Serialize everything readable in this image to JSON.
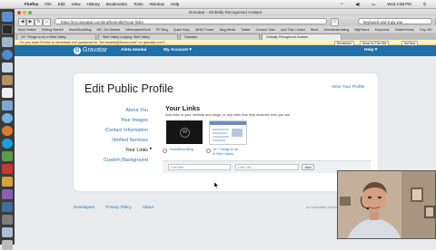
{
  "os": {
    "menu": [
      "Firefox",
      "File",
      "Edit",
      "View",
      "History",
      "Bookmarks",
      "Tools",
      "Window",
      "Help"
    ],
    "clock": "Wed 4:59 PM"
  },
  "browser": {
    "window_title": "Gravatar - Globally Recognized Avatars",
    "url": "https://en.gravatar.com/profiles/edit/#your-links",
    "search_value": "keyboard and 8 qty wur",
    "bookmarks": [
      "Most Visited",
      "Getting Started",
      "HomeBuzzBlog",
      "HR- Get Started",
      "WebmasterWorld",
      "PP Blog",
      "Quick Keys",
      "WHIZ Footer",
      "Blog Wedd",
      "Twitter",
      "Custom Tube",
      "Add This Creator",
      "Blurb",
      "AlmostInteresting",
      "BigPicture",
      "Keywords",
      "Twitter/Home",
      "Tiny URL"
    ],
    "tabs": [
      "10+ Things to do in Wert Valley",
      "Wert Valley Lodging: Wert Valley",
      "Gravatar",
      "Globally Recognized Avatars"
    ],
    "notification": "Do you want Firefox to remember the password for \"bnl.tmsbtsl@bsuwr.com\" on gravatar.com?",
    "notify_buttons": [
      "Remember",
      "Never for This Site",
      "Not Now"
    ]
  },
  "header": {
    "logo": "Gravatar",
    "user": "Aleta Imedal",
    "account_menu": "My Account ▾",
    "help": "Help ▾"
  },
  "profile": {
    "title": "Edit Public Profile",
    "view_link": "View Your Profile",
    "nav": [
      "About You",
      "Your Images",
      "Contact Information",
      "Verified Services",
      "Your Links",
      "Custom Background"
    ],
    "section_title": "Your Links",
    "section_desc": "Add links to your website and blogs, or any sites that help describe who you are.",
    "links": [
      {
        "label": "HomeBuzzBlog"
      },
      {
        "label1": "10+ Things to do",
        "label2": "in Wert Valley"
      }
    ],
    "link_title_placeholder": "Link title...",
    "link_url_placeholder": "Link URL...",
    "add_label": "Add"
  },
  "footer": {
    "links": [
      "Developers",
      "Privacy Policy",
      "About"
    ],
    "right_text": "An Automattic venture"
  },
  "colors": {
    "header": "#1f6fa8",
    "link": "#2b73b8"
  }
}
